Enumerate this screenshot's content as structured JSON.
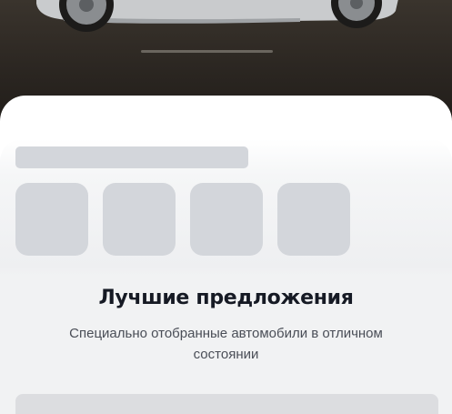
{
  "hero": {
    "image_name": "car-photo"
  },
  "offers": {
    "title": "Лучшие предложения",
    "subtitle": "Специально отобранные автомобили в отличном состоянии"
  },
  "colors": {
    "title": "#161a24",
    "subtitle": "#4a4e57",
    "skeleton": "#d3d6db",
    "sheet": "#ffffff"
  }
}
